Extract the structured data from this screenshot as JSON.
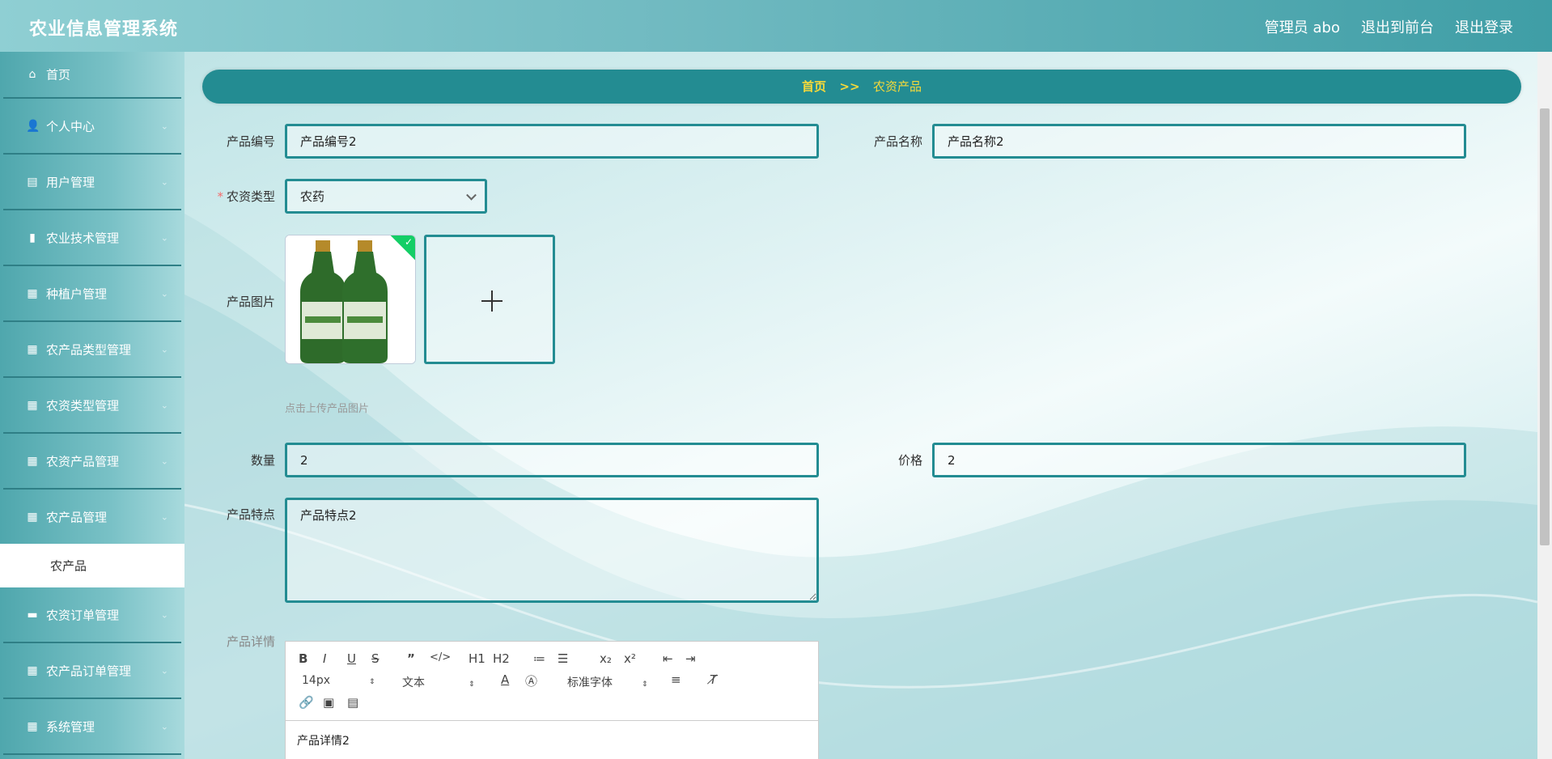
{
  "app": {
    "title": "农业信息管理系统"
  },
  "topnav": {
    "admin": "管理员 abo",
    "front": "退出到前台",
    "logout": "退出登录"
  },
  "sidebar": {
    "items": [
      {
        "label": "首页",
        "icon": "home-icon"
      },
      {
        "label": "个人中心",
        "icon": "user-icon"
      },
      {
        "label": "用户管理",
        "icon": "clipboard-icon"
      },
      {
        "label": "农业技术管理",
        "icon": "bar-chart-icon"
      },
      {
        "label": "种植户管理",
        "icon": "grid-icon"
      },
      {
        "label": "农产品类型管理",
        "icon": "grid-icon"
      },
      {
        "label": "农资类型管理",
        "icon": "grid-icon"
      },
      {
        "label": "农资产品管理",
        "icon": "grid-icon"
      },
      {
        "label": "农产品管理",
        "icon": "grid-icon"
      },
      {
        "label": "农资订单管理",
        "icon": "monitor-icon"
      },
      {
        "label": "农产品订单管理",
        "icon": "grid-icon"
      },
      {
        "label": "系统管理",
        "icon": "grid-icon"
      }
    ],
    "sub_item": "农产品"
  },
  "breadcrumb": {
    "home": "首页",
    "sep": ">>",
    "current": "农资产品"
  },
  "form": {
    "code_label": "产品编号",
    "code_value": "产品编号2",
    "name_label": "产品名称",
    "name_value": "产品名称2",
    "type_label": "农资类型",
    "type_value": "农药",
    "image_label": "产品图片",
    "image_hint": "点击上传产品图片",
    "qty_label": "数量",
    "qty_value": "2",
    "price_label": "价格",
    "price_value": "2",
    "feature_label": "产品特点",
    "feature_value": "产品特点2",
    "detail_label": "产品详情",
    "detail_value": "产品详情2"
  },
  "editor": {
    "font_size": "14px",
    "text_style": "文本",
    "font_family": "标准字体",
    "h1": "H1",
    "h2": "H2"
  },
  "colors": {
    "accent": "#238c92",
    "breadcrumb_text": "#f5d93a",
    "success": "#13ce66"
  }
}
